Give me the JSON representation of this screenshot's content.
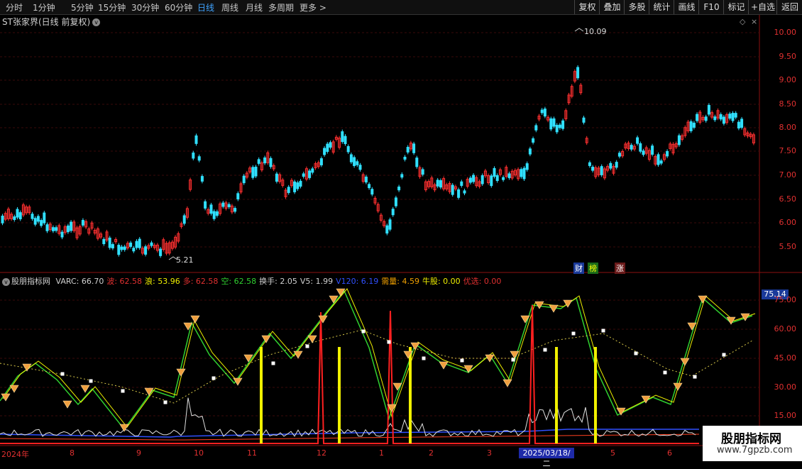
{
  "toolbar": {
    "timeframes": [
      "分时",
      "1分钟",
      "5分钟",
      "15分钟",
      "30分钟",
      "60分钟",
      "日线",
      "周线",
      "月线",
      "多周期",
      "更多 >"
    ],
    "active": "日线",
    "right_buttons": [
      "复权",
      "叠加",
      "多股",
      "统计",
      "画线",
      "F10",
      "标记",
      "+自选",
      "返回"
    ]
  },
  "stock_title": "ST张家界(日线 前复权)",
  "price_axis": [
    "10.00",
    "9.50",
    "9.00",
    "8.50",
    "8.00",
    "7.50",
    "7.00",
    "6.50",
    "6.00",
    "5.50"
  ],
  "price_high_label": "10.09",
  "price_low_label": "5.21",
  "tags": [
    "财",
    "榜",
    "涨"
  ],
  "indicator": {
    "name": "股朋指标网",
    "items": [
      {
        "label": "VARC: 66.70",
        "color": "#d0d0d0"
      },
      {
        "label": "波: 62.58",
        "color": "#e03030"
      },
      {
        "label": "浪: 53.96",
        "color": "#f0f000"
      },
      {
        "label": "多: 62.58",
        "color": "#e03030"
      },
      {
        "label": "空: 62.58",
        "color": "#30d030"
      },
      {
        "label": "换手: 2.05",
        "color": "#d0d0d0"
      },
      {
        "label": "V5: 1.99",
        "color": "#d0d0d0"
      },
      {
        "label": "V120: 6.19",
        "color": "#3050ff"
      },
      {
        "label": "需量: 4.59",
        "color": "#f0a000"
      },
      {
        "label": "牛股: 0.00",
        "color": "#f0f000"
      },
      {
        "label": "优选: 0.00",
        "color": "#e03030"
      }
    ]
  },
  "indicator_axis": [
    "75.00",
    "60.00",
    "45.00",
    "30.00",
    "15.00"
  ],
  "indicator_value_badge": "75.14",
  "x_axis": [
    "2024年",
    "8",
    "9",
    "10",
    "11",
    "12",
    "1",
    "2",
    "3",
    "2025/03/18/二",
    "5",
    "6"
  ],
  "watermark": {
    "title": "股朋指标网",
    "url": "www.7gpzb.com"
  }
}
